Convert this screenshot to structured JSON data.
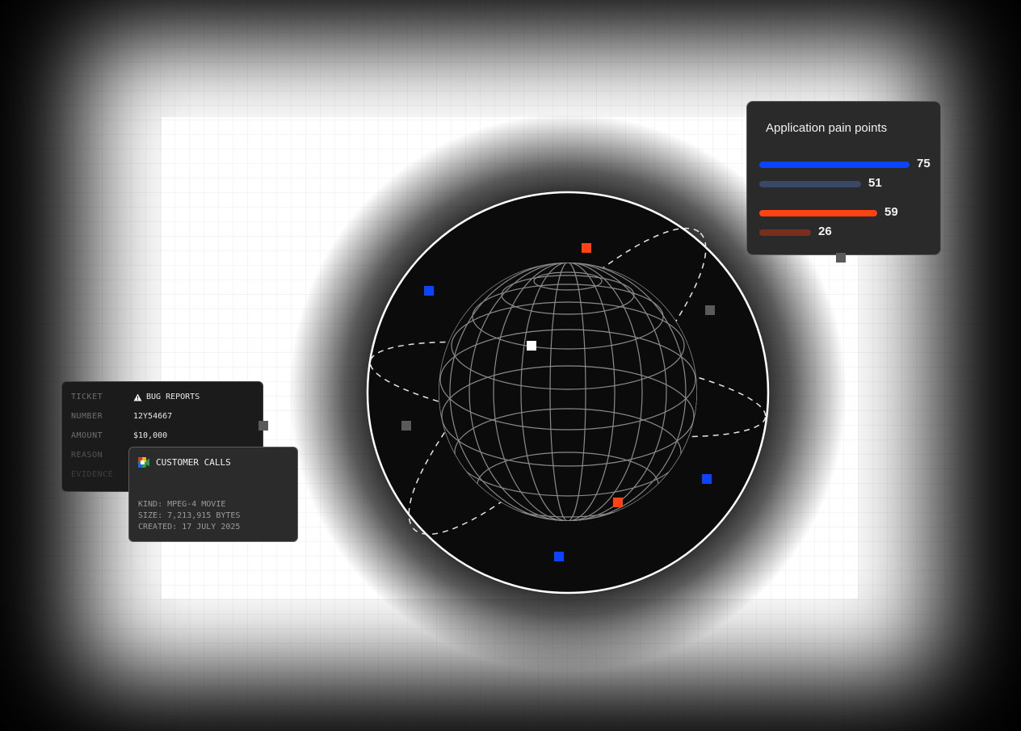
{
  "pain_points": {
    "title": "Application pain points",
    "bars": [
      {
        "value": 75,
        "color": "#0b44ff"
      },
      {
        "value": 51,
        "color": "#3b4766"
      },
      {
        "value": 59,
        "color": "#ff4313"
      },
      {
        "value": 26,
        "color": "#7a2e1f"
      }
    ]
  },
  "bug_reports": {
    "rows": [
      {
        "key": "TICKET",
        "value": "BUG REPORTS",
        "icon": "warning-icon"
      },
      {
        "key": "NUMBER",
        "value": "12Y54667"
      },
      {
        "key": "AMOUNT",
        "value": "$10,000"
      },
      {
        "key": "REASON",
        "value": ""
      },
      {
        "key": "EVIDENCE",
        "value": ""
      }
    ]
  },
  "customer_calls": {
    "title": "CUSTOMER CALLS",
    "icon": "meet-icon",
    "kind": "KIND: MPEG-4 MOVIE",
    "size": "SIZE: 7,213,915 BYTES",
    "created": "CREATED: 17 JULY 2025"
  },
  "colors": {
    "blue": "#0b44ff",
    "orange": "#ff4313",
    "gray_node": "#5a5a5a",
    "panel": "#2a2a2a"
  }
}
